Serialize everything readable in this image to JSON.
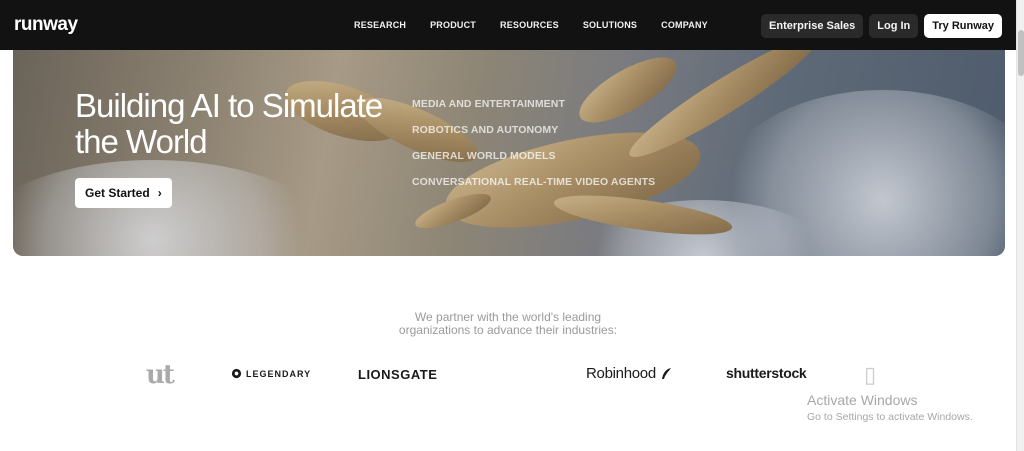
{
  "nav": {
    "logo": "runway",
    "links": [
      "RESEARCH",
      "PRODUCT",
      "RESOURCES",
      "SOLUTIONS",
      "COMPANY"
    ],
    "enterprise_label": "Enterprise Sales",
    "login_label": "Log In",
    "try_label": "Try Runway"
  },
  "hero": {
    "title": "Building AI to Simulate the World",
    "cta_label": "Get Started",
    "cta_icon": "chevron-right-icon",
    "categories": [
      "MEDIA AND ENTERTAINMENT",
      "ROBOTICS AND AUTONOMY",
      "GENERAL WORLD MODELS",
      "CONVERSATIONAL REAL-TIME VIDEO AGENTS"
    ]
  },
  "partners": {
    "line1": "We partner with the world's leading",
    "line2": "organizations to advance their industries:",
    "logos": {
      "ut": "ut",
      "legendary": "LEGENDARY",
      "lionsgate": "LIONSGATE",
      "robinhood": "Robinhood",
      "shutterstock": "shutterstock"
    }
  },
  "overlay": {
    "title": "Activate Windows",
    "subtitle": "Go to Settings to activate Windows."
  },
  "colors": {
    "nav_bg": "#121212",
    "accent_white": "#ffffff",
    "muted_text": "#9a9a9a"
  }
}
